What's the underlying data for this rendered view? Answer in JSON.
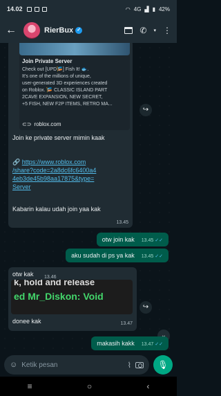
{
  "status": {
    "time": "14.02",
    "battery": "42%",
    "signal": "4G"
  },
  "header": {
    "contact_name": "RierBux"
  },
  "messages": {
    "link_preview": {
      "title": "Join Private Server",
      "desc_lines": [
        "Check out [UPD🎏] Fish It! 🐟.",
        "It’s one of the millions of unique,",
        "user-generated 3D experiences created",
        "on Roblox. 🎏 CLASSIC ISLAND PART",
        "2CAVE EXPANSION, NEW SECRET,",
        "+5 FISH, NEW F2P ITEMS, RETRO MA..."
      ],
      "domain": "roblox.com"
    },
    "invite_text": "Join ke private server mimin kaak",
    "link_prefix": "🔗",
    "link_lines": [
      "https://www.roblox.com",
      "/share?code=2a8dc6fc6400a4",
      "4eb3de45b98aa17875&type=",
      "Server"
    ],
    "closing_text": "Kabarin kalau udah join yaa kak",
    "closing_time": "13.45",
    "out1_text": "otw join kak",
    "out1_time": "13.45",
    "out2_text": "aku sudah di ps ya kak",
    "out2_time": "13.45",
    "in2_text": "otw kak",
    "in2_time": "13.46",
    "sticker_line1": "k, hold and release",
    "sticker_line2": "ed Mr_Diskon: Void",
    "in3_text": "donee kak",
    "in3_time": "13.47",
    "out3_text": "makasih kakk",
    "out3_time": "13.47"
  },
  "composer": {
    "placeholder": "Ketik pesan"
  }
}
